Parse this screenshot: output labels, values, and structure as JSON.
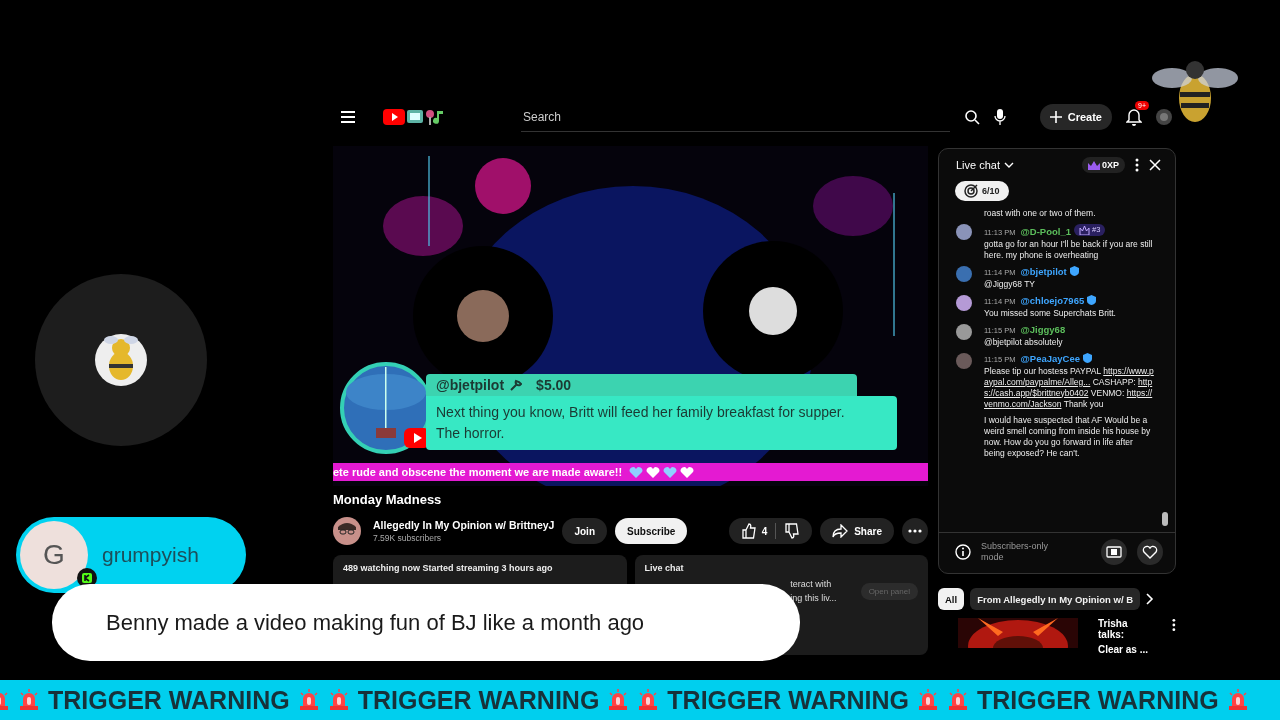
{
  "header": {
    "search": {
      "placeholder": "Search"
    },
    "create_label": "Create",
    "notification_count": "9+"
  },
  "video": {
    "ticker_text": "ete rude and obscene the moment we are made aware!!",
    "hearts": [
      {
        "color": "#8fd0ff"
      },
      {
        "color": "#ffffff"
      },
      {
        "color": "#8fd0ff"
      },
      {
        "color": "#ffffff"
      }
    ]
  },
  "title": "Monday Madness",
  "channel": {
    "name": "Allegedly In My Opinion w/ BrittneyJ",
    "subscribers": "7.59K subscribers",
    "join": "Join",
    "subscribe": "Subscribe",
    "likes": "4",
    "share": "Share"
  },
  "info_card": {
    "text": "489 watching now  Started streaming 3 hours ago"
  },
  "chat_card": {
    "title": "Live chat",
    "lines": [
      "teract with",
      "ing this liv..."
    ],
    "button": "Open panel"
  },
  "live_chat": {
    "title": "Live chat",
    "xp": "0XP",
    "goal": "6/10",
    "messages": [
      {
        "kind": "continuation",
        "text": "roast with one or two of them."
      },
      {
        "kind": "message",
        "time": "11:13 PM",
        "author": "@D-Pool_1",
        "color": "#5cbf5c",
        "rank": "#3",
        "text": "gotta go for an hour I'll be back if you are still here. my phone is overheating"
      },
      {
        "kind": "message",
        "time": "11:14 PM",
        "author": "@bjetpilot",
        "color": "#3ea6ff",
        "member": true,
        "text": "@Jiggy68 TY"
      },
      {
        "kind": "message",
        "time": "11:14 PM",
        "author": "@chloejo7965",
        "color": "#3ea6ff",
        "member": true,
        "text": "You missed some Superchats Britt."
      },
      {
        "kind": "message",
        "time": "11:15 PM",
        "author": "@Jiggy68",
        "color": "#5cbf5c",
        "text": "@bjetpilot absolutely"
      },
      {
        "kind": "message",
        "time": "11:15 PM",
        "author": "@PeaJayCee",
        "color": "#3ea6ff",
        "member": true,
        "parts": [
          {
            "text": "Please tip our hostess PAYPAL ",
            "link": false
          },
          {
            "text": "https://www.paypal.com/paypalme/Alleg...",
            "link": true
          },
          {
            "text": " CASHAPP: ",
            "link": false
          },
          {
            "text": "https://cash.app/$brittneyb0402",
            "link": true
          },
          {
            "text": " VENMO: ",
            "link": false
          },
          {
            "text": "https://venmo.com/Jackson",
            "link": true
          },
          {
            "text": " Thank you",
            "link": false
          }
        ]
      },
      {
        "kind": "continuation",
        "text": "I would have suspected that AF Would be a weird smell coming from inside his house by now. How do you go forward in life after being exposed? He can't."
      }
    ],
    "footer": "Subscribers-only mode"
  },
  "chips": [
    {
      "label": "All",
      "selected": true
    },
    {
      "label": "From Allegedly In My Opinion w/ B",
      "selected": false
    }
  ],
  "recommendation": {
    "title_lines": [
      "Trisha talks:",
      "Clear as ..."
    ]
  },
  "superchat": {
    "author": "@bjetpilot",
    "amount": "$5.00",
    "message": "Next thing you know, Britt will feed her family breakfast for supper. The horror."
  },
  "viewer_comment": {
    "initial": "G",
    "name": "grumpyish",
    "message": "Benny made a video making fun of BJ like a month ago"
  },
  "warning_ticker": {
    "items": [
      "TRIGGER WARNING",
      "TRIGGER WARNING",
      "TRIGGER WARNING",
      "TRIGGER WARNING"
    ]
  }
}
